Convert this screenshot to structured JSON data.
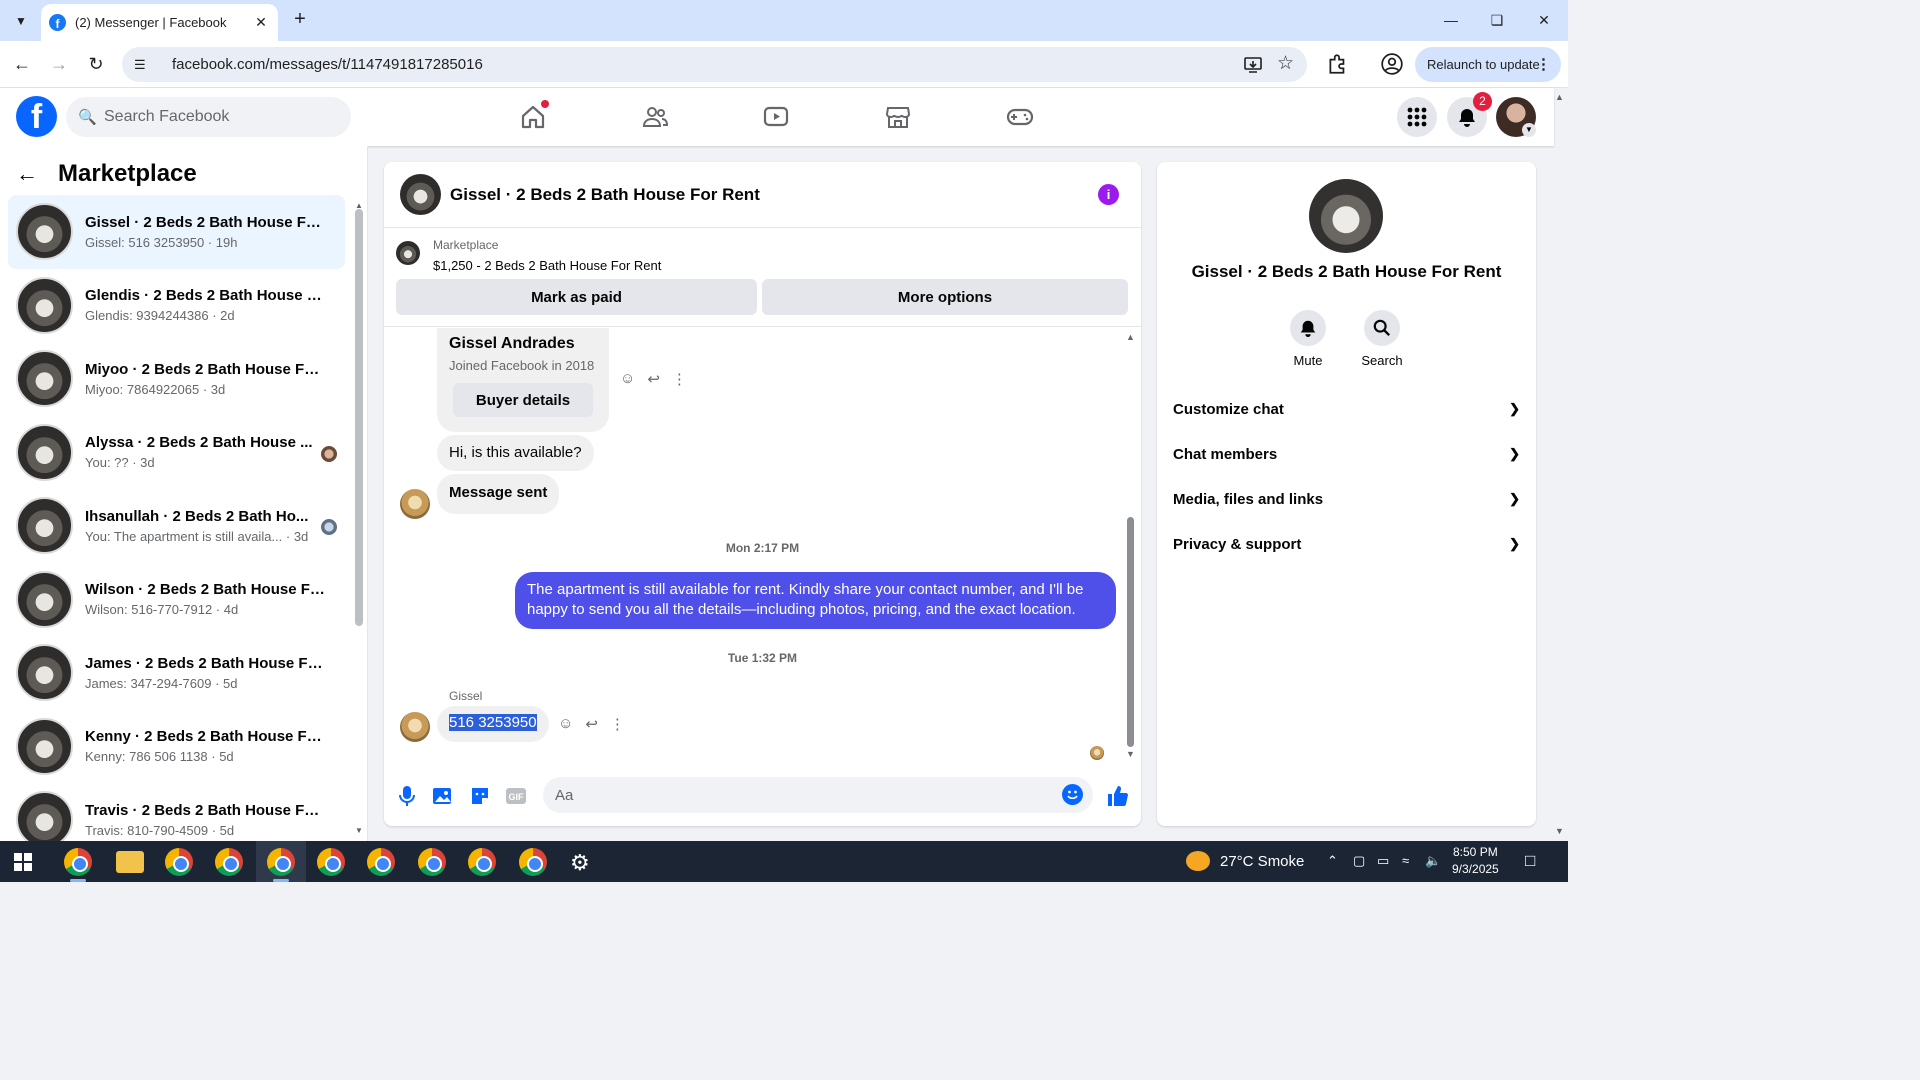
{
  "browser": {
    "tab_title": "(2) Messenger | Facebook",
    "url": "facebook.com/messages/t/1147491817285016",
    "relaunch_label": "Relaunch to update"
  },
  "fb": {
    "search_placeholder": "Search Facebook",
    "notification_count": "2",
    "brand_color": "#0866ff"
  },
  "sidebar": {
    "title": "Marketplace",
    "conversations": [
      {
        "name": "Gissel · 2 Beds 2 Bath House For...",
        "preview": "Gissel: 516 3253950 · 19h"
      },
      {
        "name": "Glendis · 2 Beds 2 Bath House F...",
        "preview": "Glendis: 9394244386 · 2d"
      },
      {
        "name": "Miyoo · 2 Beds 2 Bath House Fo...",
        "preview": "Miyoo: 7864922065 · 3d"
      },
      {
        "name": "Alyssa · 2 Beds 2 Bath House ...",
        "preview": "You: ?? · 3d"
      },
      {
        "name": "Ihsanullah · 2 Beds 2 Bath Ho...",
        "preview": "You: The apartment is still availa... · 3d"
      },
      {
        "name": "Wilson · 2 Beds 2 Bath House Fo...",
        "preview": "Wilson: 516-770-7912 · 4d"
      },
      {
        "name": "James · 2 Beds 2 Bath House For...",
        "preview": "James: 347-294-7609 · 5d"
      },
      {
        "name": "Kenny · 2 Beds 2 Bath House For...",
        "preview": "Kenny: 786 506 1138 · 5d"
      },
      {
        "name": "Travis · 2 Beds 2 Bath House For ...",
        "preview": "Travis: 810-790-4509 · 5d"
      }
    ]
  },
  "chat": {
    "title": "Gissel · 2 Beds 2 Bath House For Rent",
    "marketplace_label": "Marketplace",
    "listing": "$1,250 - 2 Beds 2 Bath House For Rent",
    "mark_paid_label": "Mark as paid",
    "more_options_label": "More options",
    "buyer_name": "Gissel Andrades",
    "buyer_joined": "Joined Facebook in 2018",
    "buyer_details_label": "Buyer details",
    "msg_available": "Hi, is this available?",
    "msg_sent": "Message sent",
    "ts1": "Mon 2:17 PM",
    "my_reply": "The apartment is still available for rent. Kindly share your contact number, and I'll be happy to send you all the details—including photos, pricing, and the exact location.",
    "ts2": "Tue 1:32 PM",
    "sender_label": "Gissel",
    "phone_msg": "516 3253950",
    "composer_placeholder": "Aa",
    "bubble_color": "#4f4fe9"
  },
  "info": {
    "name": "Gissel · 2 Beds 2 Bath House For Rent",
    "mute_label": "Mute",
    "search_label": "Search",
    "sections": [
      "Customize chat",
      "Chat members",
      "Media, files and links",
      "Privacy & support"
    ]
  },
  "taskbar": {
    "weather": "27°C  Smoke",
    "time": "8:50 PM",
    "date": "9/3/2025"
  }
}
